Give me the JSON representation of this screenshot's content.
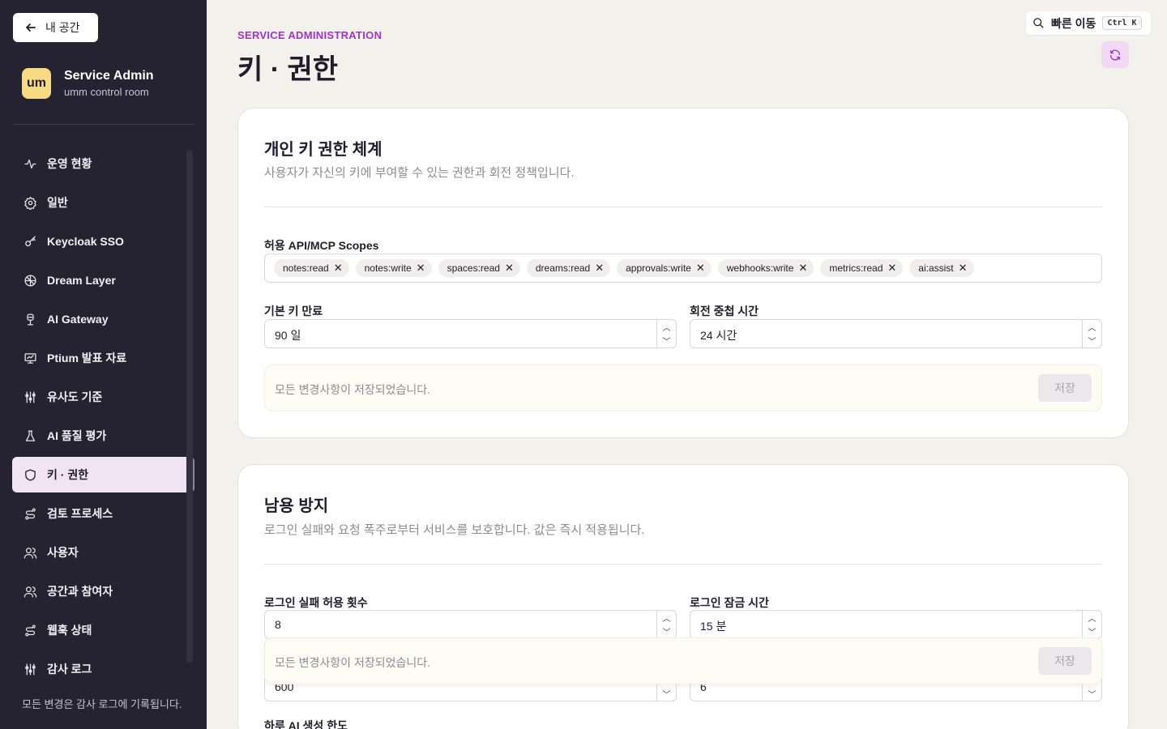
{
  "sidebar": {
    "back_label": "내 공간",
    "brand_logo": "um",
    "brand_title": "Service Admin",
    "brand_sub": "umm control room",
    "items": [
      {
        "label": "운영 현황",
        "icon": "activity-icon"
      },
      {
        "label": "일반",
        "icon": "gear-icon"
      },
      {
        "label": "Keycloak SSO",
        "icon": "key-icon"
      },
      {
        "label": "Dream Layer",
        "icon": "layers-icon"
      },
      {
        "label": "AI Gateway",
        "icon": "gateway-icon"
      },
      {
        "label": "Ptium 발표 자료",
        "icon": "presentation-icon"
      },
      {
        "label": "유사도 기준",
        "icon": "sliders-icon"
      },
      {
        "label": "AI 품질 평가",
        "icon": "flask-icon"
      },
      {
        "label": "키 · 권한",
        "icon": "shield-icon"
      },
      {
        "label": "검토 프로세스",
        "icon": "route-icon"
      },
      {
        "label": "사용자",
        "icon": "users-icon"
      },
      {
        "label": "공간과 참여자",
        "icon": "users-icon"
      },
      {
        "label": "웹훅 상태",
        "icon": "route-icon"
      },
      {
        "label": "감사 로그",
        "icon": "sliders-icon"
      }
    ],
    "footer": "모든 변경은 감사 로그에 기록됩니다."
  },
  "header": {
    "eyebrow": "SERVICE ADMINISTRATION",
    "title": "키 · 권한",
    "quick_nav_label": "빠른 이동",
    "quick_nav_kbd": "Ctrl K"
  },
  "card1": {
    "title": "개인 키 권한 체계",
    "desc": "사용자가 자신의 키에 부여할 수 있는 권한과 회전 정책입니다.",
    "scopes_label": "허용 API/MCP Scopes",
    "scopes": [
      "notes:read",
      "notes:write",
      "spaces:read",
      "dreams:read",
      "approvals:write",
      "webhooks:write",
      "metrics:read",
      "ai:assist"
    ],
    "expiry_label": "기본 키 만료",
    "expiry_value": "90 일",
    "overlap_label": "회전 중첩 시간",
    "overlap_value": "24 시간",
    "save_msg": "모든 변경사항이 저장되었습니다.",
    "save_label": "저장"
  },
  "card2": {
    "title": "남용 방지",
    "desc": "로그인 실패와 요청 폭주로부터 서비스를 보호합니다. 값은 즉시 적용됩니다.",
    "fail_label": "로그인 실패 허용 횟수",
    "fail_value": "8",
    "lock_label": "로그인 잠금 시간",
    "lock_value": "15 분",
    "rate_value": "600",
    "other_value": "6",
    "daily_label": "하루 AI 생성 한도",
    "save_msg": "모든 변경사항이 저장되었습니다.",
    "save_label": "저장"
  }
}
